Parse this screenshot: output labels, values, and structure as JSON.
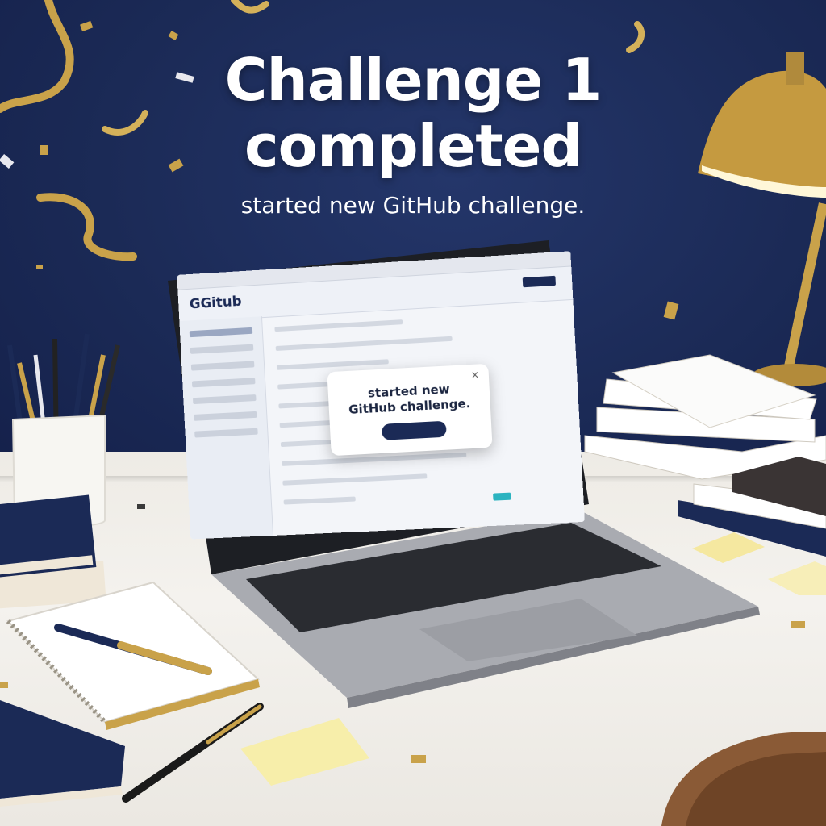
{
  "headline": {
    "line1": "Challenge 1",
    "line2": "completed",
    "subtitle": "started new GitHub challenge."
  },
  "laptop_screen": {
    "logo": "GGitub",
    "notification": {
      "line1": "started new",
      "line2": "GitHub challenge.",
      "close": "×"
    }
  },
  "colors": {
    "wall": "#1b2a56",
    "desk": "#efece6",
    "gold": "#c9a24a",
    "navy": "#1b2a56",
    "sticky_note": "#f7eeaa"
  },
  "icons": [
    "confetti",
    "desk-lamp",
    "pen-holder",
    "notebook",
    "pen",
    "sticky-note",
    "laptop",
    "chair"
  ]
}
